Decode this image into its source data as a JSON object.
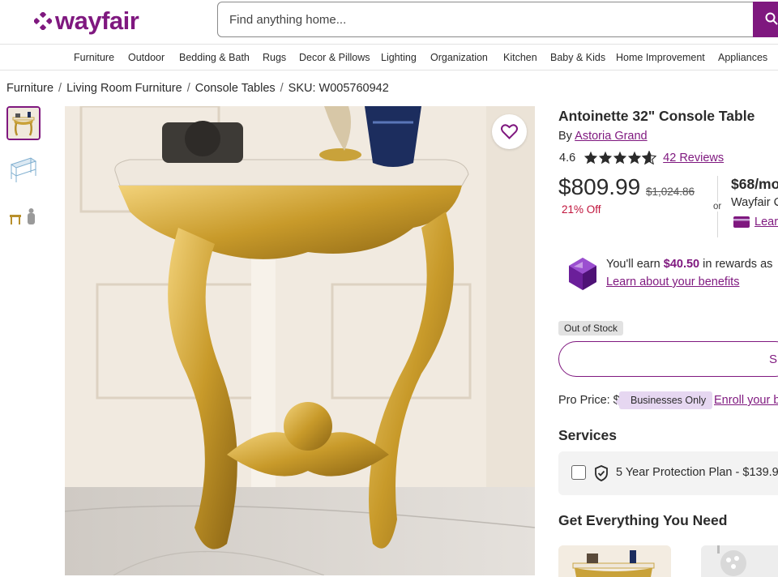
{
  "brand": {
    "logo_text": "wayfair",
    "accent": "#7f187f",
    "sale_color": "#c0143c"
  },
  "search": {
    "placeholder": "Find anything home...",
    "icon": "search-icon"
  },
  "nav": {
    "items": [
      "Furniture",
      "Outdoor",
      "Bedding & Bath",
      "Rugs",
      "Decor & Pillows",
      "Lighting",
      "Organization",
      "Kitchen",
      "Baby & Kids",
      "Home Improvement",
      "Appliances"
    ]
  },
  "breadcrumb": [
    "Furniture",
    "Living Room Furniture",
    "Console Tables",
    "SKU: W005760942"
  ],
  "product": {
    "title": "Antoinette 32\" Console Table",
    "by_prefix": "By",
    "brand": "Astoria Grand",
    "rating": "4.6",
    "stars_filled": 4.6,
    "reviews": "42 Reviews",
    "price": "$809.99",
    "was_price": "$1,024.86",
    "discount": "21% Off",
    "or_text": "or",
    "monthly": "$68/mo",
    "card_name": "Wayfair C",
    "card_learn": "Lear",
    "rewards_prefix": "You'll earn ",
    "rewards_amount": "$40.50",
    "rewards_suffix": " in rewards as",
    "rewards_link": "Learn about your benefits",
    "stock": "Out of Stock",
    "notify_button": "S",
    "pro_price_label": "Pro Price: $",
    "biz_badge": "Businesses Only",
    "enroll_link": "Enroll your b"
  },
  "services": {
    "heading": "Services",
    "item_label": "5 Year Protection Plan - $139.9"
  },
  "get_everything": {
    "heading": "Get Everything You Need"
  }
}
